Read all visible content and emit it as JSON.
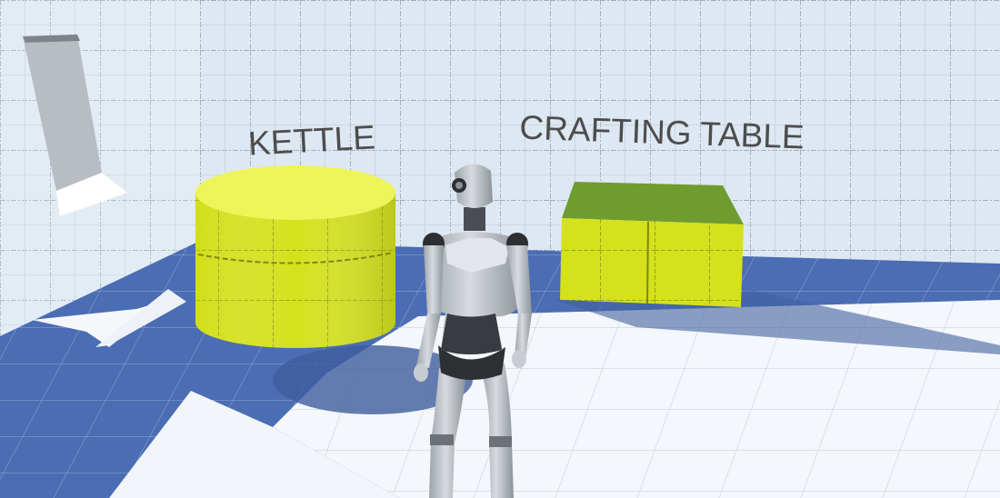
{
  "scene": {
    "labels": {
      "kettle": "KETTLE",
      "crafting_table": "CRAFTING TABLE"
    },
    "colors": {
      "wall": "#dbe6f1",
      "floor_blue": "#4c6fb5",
      "floor_white": "#f3f6fa",
      "object_yellow": "#d6e31c",
      "object_yellow_top": "#eef55a",
      "table_top": "#6b9a2c",
      "robot_body": "#bfc4ca",
      "robot_dark": "#2d2f33",
      "label_text": "#4d4d4d"
    },
    "objects": [
      {
        "name": "kettle",
        "shape": "cylinder"
      },
      {
        "name": "crafting-table",
        "shape": "box"
      },
      {
        "name": "player-robot",
        "shape": "humanoid"
      }
    ]
  }
}
